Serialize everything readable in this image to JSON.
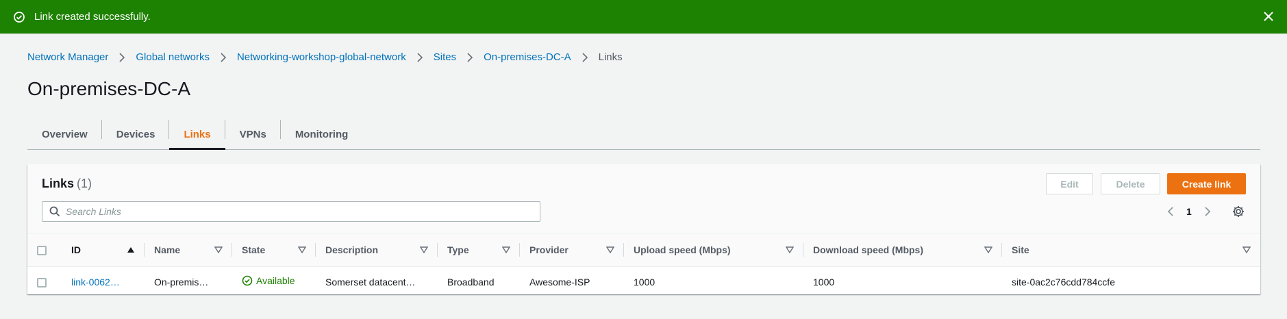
{
  "flash": {
    "message": "Link created successfully.",
    "icon": "success-circle-icon",
    "close_icon": "close-icon",
    "color": "#1d8102"
  },
  "breadcrumb": {
    "items": [
      "Network Manager",
      "Global networks",
      "Networking-workshop-global-network",
      "Sites",
      "On-premises-DC-A"
    ],
    "current": "Links"
  },
  "page_title": "On-premises-DC-A",
  "tabs": [
    "Overview",
    "Devices",
    "Links",
    "VPNs",
    "Monitoring"
  ],
  "active_tab": "Links",
  "panel": {
    "title": "Links",
    "count": "(1)",
    "edit_label": "Edit",
    "delete_label": "Delete",
    "create_label": "Create link",
    "search_placeholder": "Search Links",
    "page": "1"
  },
  "table": {
    "columns": [
      "ID",
      "Name",
      "State",
      "Description",
      "Type",
      "Provider",
      "Upload speed (Mbps)",
      "Download speed (Mbps)",
      "Site"
    ],
    "rows": [
      {
        "id": "link-0062…",
        "name": "On-premis…",
        "state": "Available",
        "description": "Somerset datacent…",
        "type": "Broadband",
        "provider": "Awesome-ISP",
        "upload": "1000",
        "download": "1000",
        "site": "site-0ac2c76cdd784ccfe"
      }
    ]
  },
  "colors": {
    "accent": "#ec7211",
    "link": "#0073bb",
    "success": "#1d8102"
  }
}
